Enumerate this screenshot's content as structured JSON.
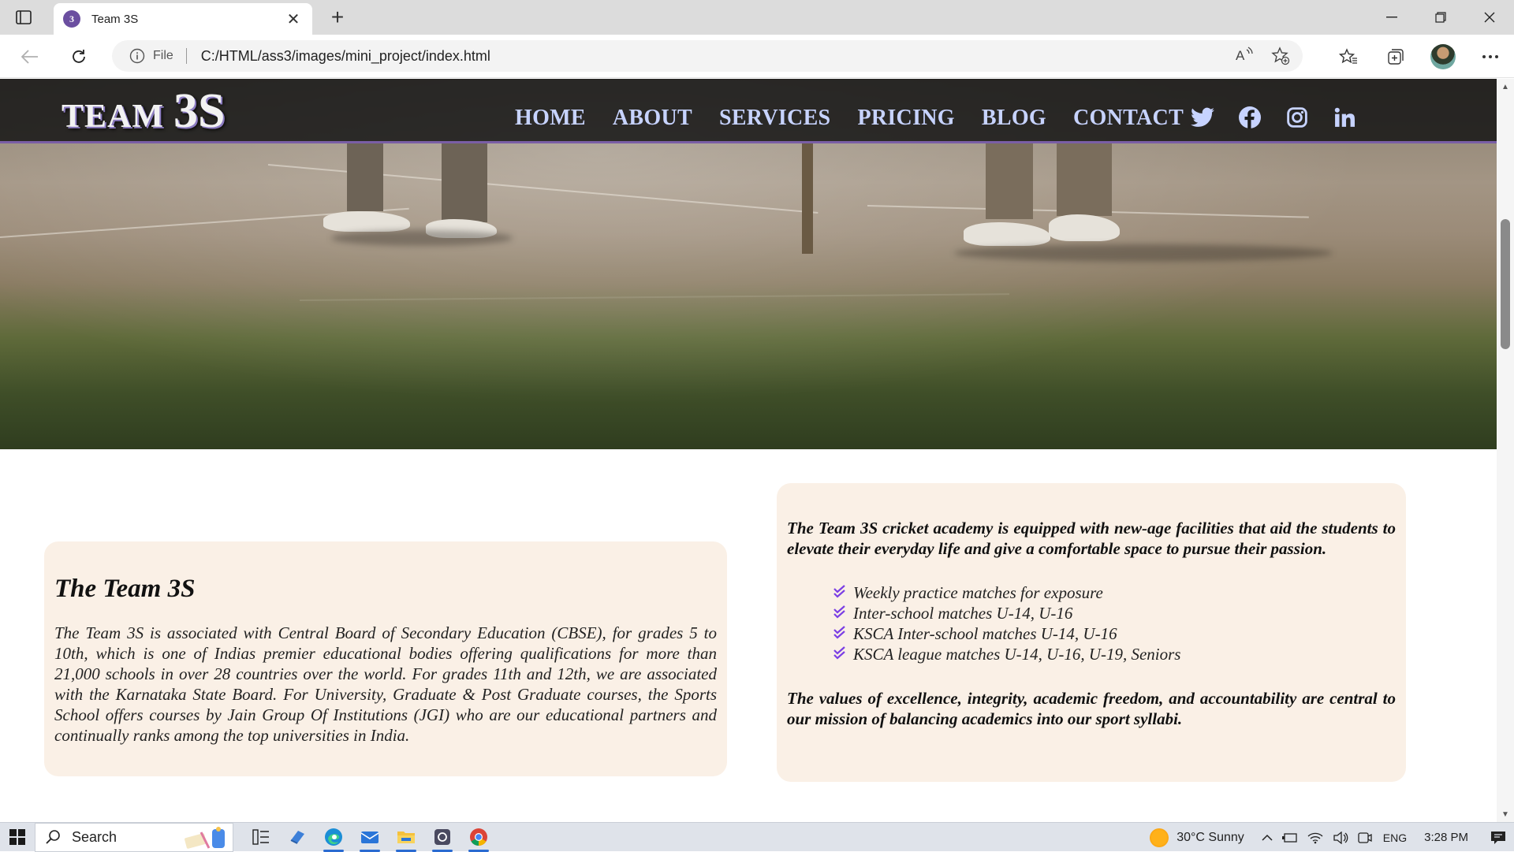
{
  "browser": {
    "tab_title": "Team 3S",
    "url_scheme_label": "File",
    "url": "C:/HTML/ass3/images/mini_project/index.html"
  },
  "site": {
    "logo_part1": "TEAM",
    "logo_part2": "3S",
    "nav": [
      "HOME",
      "ABOUT",
      "SERVICES",
      "PRICING",
      "BLOG",
      "CONTACT"
    ],
    "social_icons": [
      "twitter-icon",
      "facebook-icon",
      "instagram-icon",
      "linkedin-icon"
    ],
    "accent_color": "#7a5ea6",
    "nav_color": "#c7d3ff"
  },
  "about_card": {
    "title": "The Team 3S",
    "body": "The Team 3S is associated with Central Board of Secondary Education (CBSE), for grades 5 to 10th, which is one of Indias premier educational bodies offering qualifications for more than 21,000 schools in over 28 countries over the world. For grades 11th and 12th, we are associated with the Karnataka State Board. For University, Graduate & Post Graduate courses, the Sports School offers courses by Jain Group Of Institutions (JGI) who are our educational partners and continually ranks among the top universities in India."
  },
  "facilities_card": {
    "lead": "The Team 3S cricket academy is equipped with new-age facilities that aid the students to elevate their everyday life and give a comfortable space to pursue their passion.",
    "items": [
      "Weekly practice matches for exposure",
      "Inter-school matches U-14, U-16",
      "KSCA Inter-school matches U-14, U-16",
      "KSCA league matches U-14, U-16, U-19, Seniors"
    ],
    "tail": "The values of excellence, integrity, academic freedom, and accountability are central to our mission of balancing academics into our sport syllabi.",
    "check_color": "#7b3fe4"
  },
  "taskbar": {
    "search_label": "Search",
    "weather": "30°C  Sunny",
    "language": "ENG",
    "time": "3:28 PM"
  }
}
